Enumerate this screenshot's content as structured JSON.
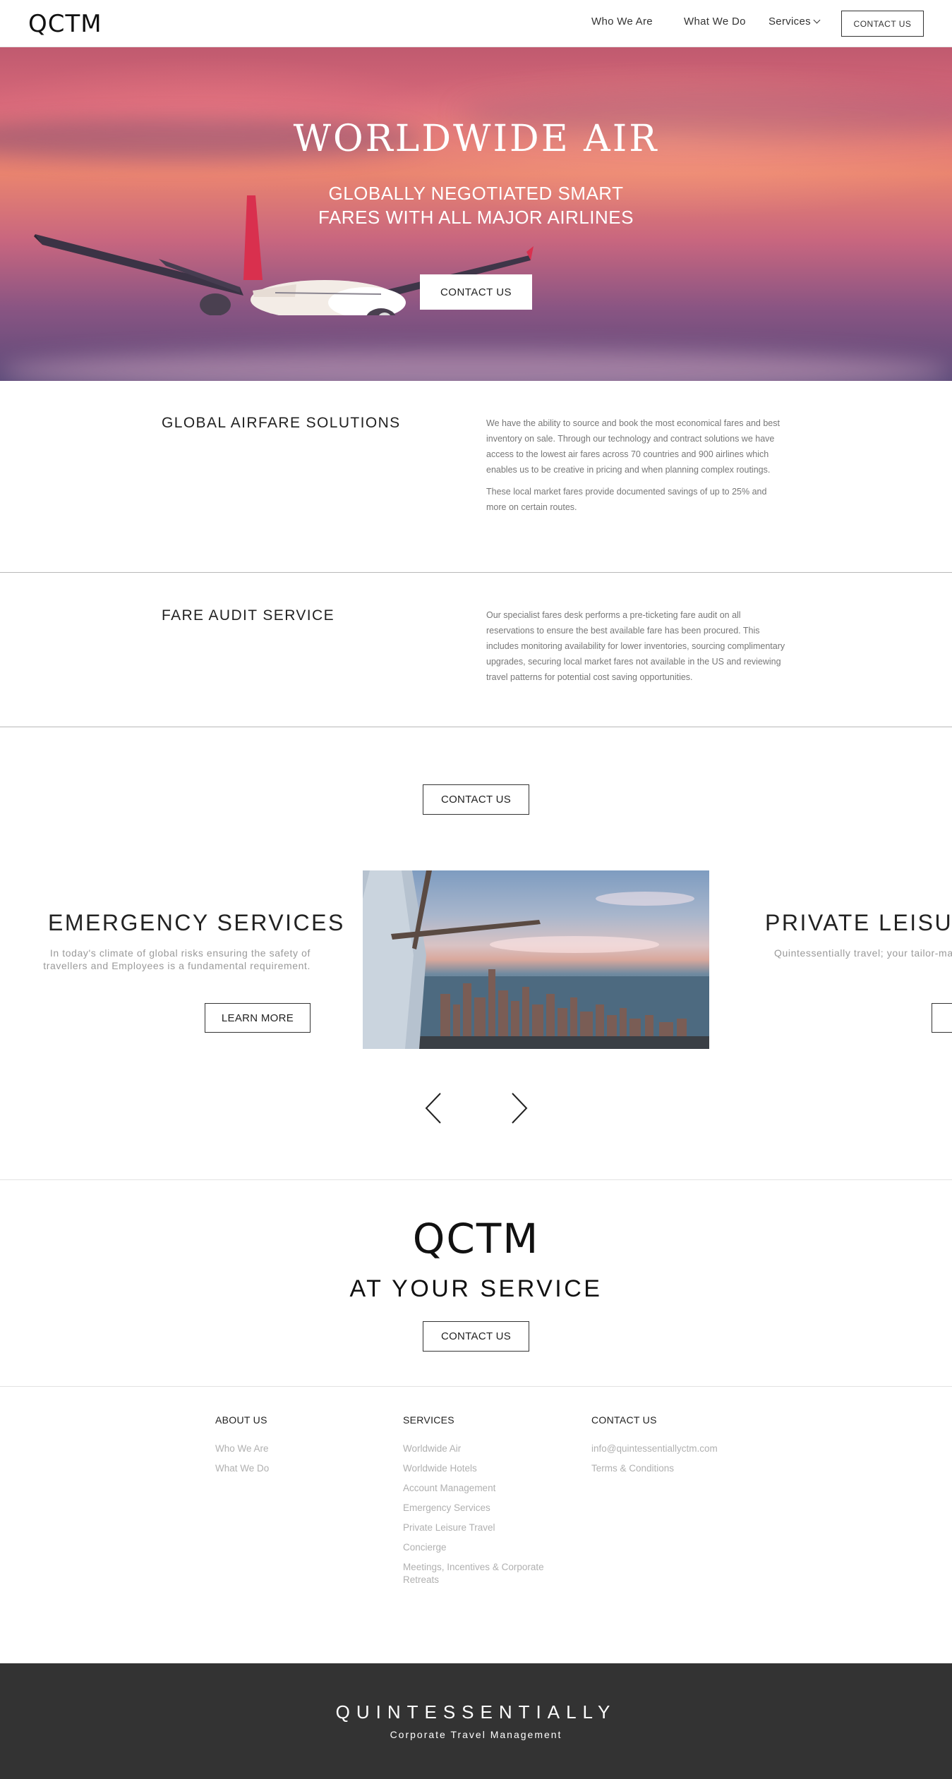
{
  "header": {
    "logo": "QCTM",
    "nav": {
      "who": "Who We Are",
      "what": "What We Do",
      "services": "Services"
    },
    "contact_button": "CONTACT US"
  },
  "hero": {
    "title": "WORLDWIDE AIR",
    "subtitle_line1": "GLOBALLY NEGOTIATED SMART",
    "subtitle_line2": "FARES WITH ALL MAJOR AIRLINES",
    "cta": "CONTACT US"
  },
  "sections": [
    {
      "title": "GLOBAL AIRFARE SOLUTIONS",
      "paragraphs": [
        "We have the ability to source and book the most economical fares and best inventory on sale. Through our technology and contract solutions we have access to the lowest air fares across 70 countries and 900 airlines which enables us to be creative in pricing and when planning complex routings.",
        "These local market fares provide documented savings of up to 25% and more on certain routes."
      ]
    },
    {
      "title": "FARE AUDIT SERVICE",
      "paragraphs": [
        "Our specialist fares desk performs a pre-ticketing fare audit on all reservations to ensure the best available fare has been procured. This includes monitoring availability for lower inventories, sourcing complimentary upgrades, securing local market fares not available in the US and reviewing travel patterns for potential cost saving opportunities."
      ]
    }
  ],
  "mid_cta": "CONTACT US",
  "slider": {
    "left": {
      "title": "EMERGENCY SERVICES",
      "text_line1": "In today's climate of global risks ensuring the safety of",
      "text_line2": "travellers and Employees is a fundamental requirement.",
      "button": "LEARN MORE"
    },
    "right": {
      "title": "PRIVATE LEISURE",
      "text": "Quintessentially travel; your tailor-ma"
    }
  },
  "brand": {
    "logo": "QCTM",
    "tagline": "AT YOUR SERVICE",
    "cta": "CONTACT US"
  },
  "footer": {
    "about": {
      "heading": "ABOUT US",
      "links": [
        "Who We Are",
        "What We Do"
      ]
    },
    "services": {
      "heading": "SERVICES",
      "links": [
        "Worldwide Air",
        "Worldwide Hotels",
        "Account Management",
        "Emergency Services",
        "Private Leisure Travel",
        "Concierge"
      ],
      "last_line1": "Meetings, Incentives & Corporate",
      "last_line2": "Retreats"
    },
    "contact": {
      "heading": "CONTACT US",
      "links": [
        "info@quintessentiallyctm.com",
        "Terms & Conditions"
      ]
    }
  },
  "bottom_bar": {
    "brand": "QUINTESSENTIALLY",
    "sub": "Corporate Travel Management"
  }
}
